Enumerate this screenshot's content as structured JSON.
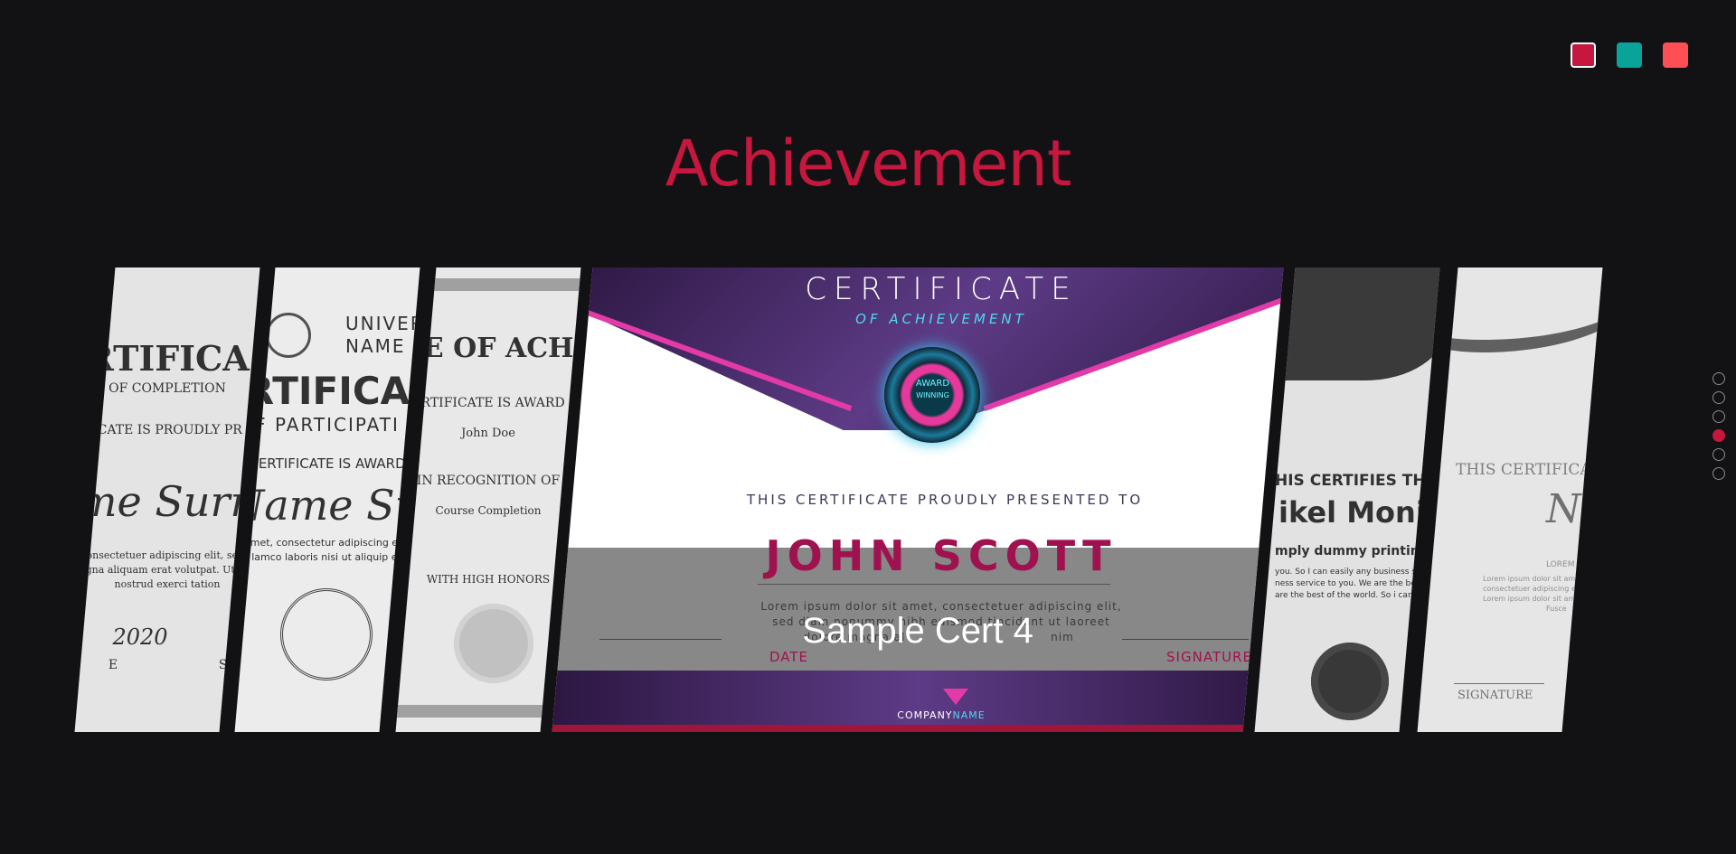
{
  "theme": {
    "background": "#121214",
    "accent": "#c6173e"
  },
  "color_swatches": [
    {
      "name": "crimson",
      "color": "#c6173e",
      "active": true
    },
    {
      "name": "teal",
      "color": "#0aa39a",
      "active": false
    },
    {
      "name": "coral",
      "color": "#ff4f55",
      "active": false
    }
  ],
  "section_title": "Achievement",
  "slides": [
    {
      "lines": [
        "RTIFICA",
        "OF COMPLETION",
        "ICATE IS PROUDLY PR",
        "me Surn",
        "consectetuer adipiscing elit, sed d",
        "agna aliquam erat volutpat. Ut wis",
        "nostrud exerci tation",
        "2020",
        "E",
        "SIG"
      ]
    },
    {
      "lines": [
        "UNIVERS",
        "NAME",
        "RTIFICA",
        "F PARTICIPATI",
        "CERTIFICATE IS AWARD",
        "Name Surn",
        "amet, consectetur adipiscing elit,",
        "lamco laboris nisi ut aliquip ex"
      ]
    },
    {
      "lines": [
        "TE OF ACH",
        "ERTIFICATE IS AWARD",
        "John Doe",
        "IN RECOGNITION OF",
        "Course Completion",
        "WITH HIGH HONORS"
      ]
    },
    {
      "certificate": "CERTIFICATE",
      "subtitle": "OF ACHIEVEMENT",
      "badge_line1": "AWARD",
      "badge_line2": "WINNING",
      "presented": "THIS CERTIFICATE PROUDLY PRESENTED TO",
      "name": "JOHN SCOTT",
      "body1": "Lorem ipsum dolor sit amet, consectetuer adipiscing elit,",
      "body2": "sed diam nonummy nibh euismod tincidunt ut laoreet",
      "body3": "dolore magna al",
      "body3_tail": "nim",
      "date": "DATE",
      "signature": "SIGNATURE",
      "company_a": "COMPANY",
      "company_b": "NAME",
      "caption": "Sample Cert 4"
    },
    {
      "lines": [
        "HIS CERTIFIES THA",
        "ikel Monir",
        "mply dummy printing d",
        "you. So I can easily any business servic",
        "ness service to you. We are the best of th",
        "are the best of the world. So i can eas"
      ]
    },
    {
      "lines": [
        "THIS CERTIFICA",
        "N",
        "LOREM IPSUM",
        "Lorem ipsum dolor sit amet",
        "consectetuer adipiscing elit sed",
        "Lorem ipsum dolor sit amet",
        "Fusce",
        "SIGNATURE"
      ]
    }
  ],
  "pagination": {
    "count": 6,
    "active_index": 3
  }
}
